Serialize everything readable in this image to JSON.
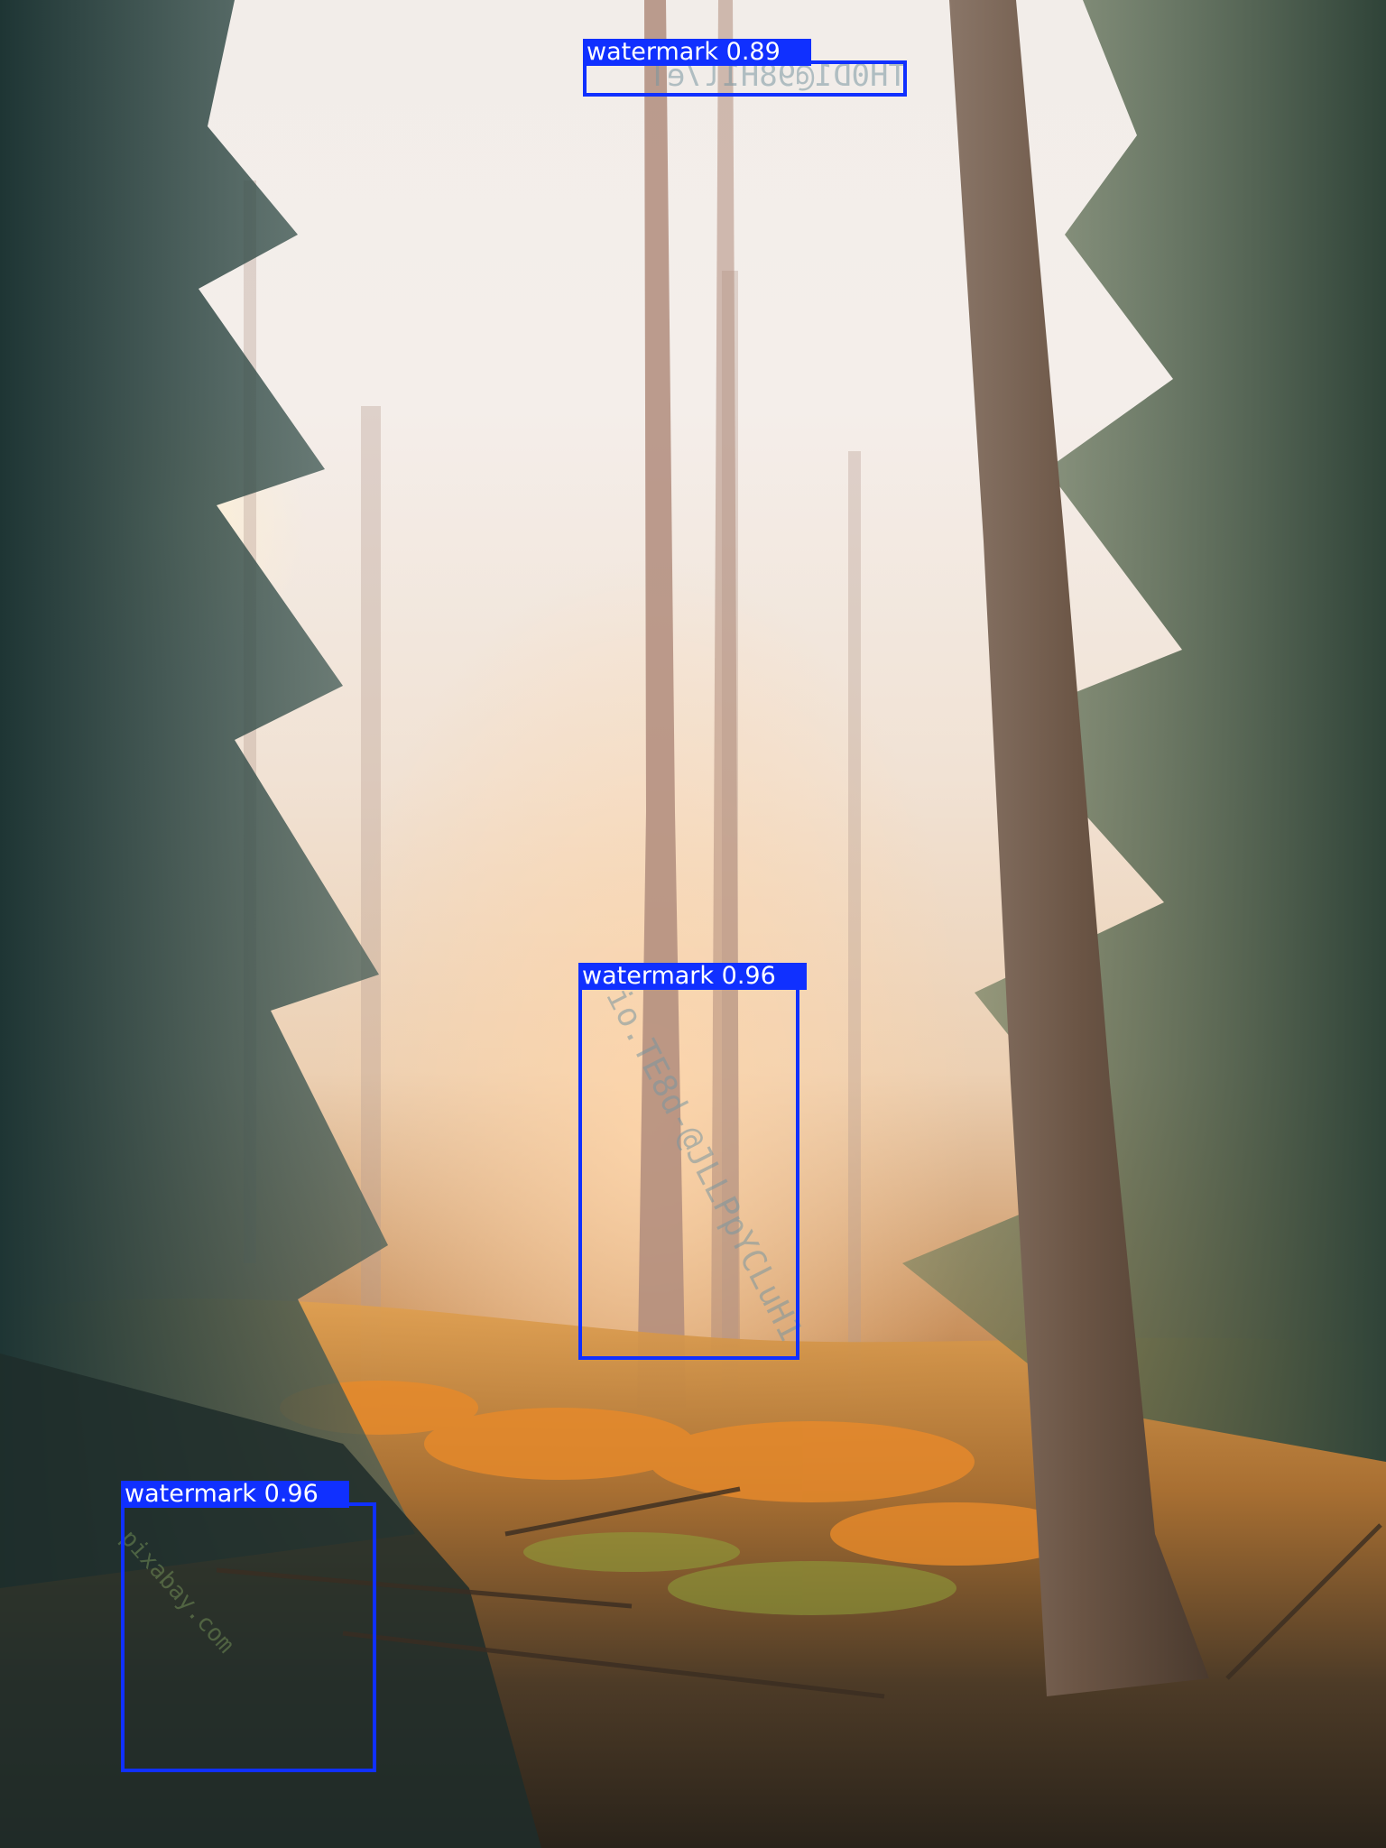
{
  "detections": [
    {
      "label": "watermark",
      "score": "0.89"
    },
    {
      "label": "watermark",
      "score": "0.96"
    },
    {
      "label": "watermark",
      "score": "0.96"
    }
  ],
  "colors": {
    "box": "#1030ff",
    "label_text": "#ffffff"
  }
}
